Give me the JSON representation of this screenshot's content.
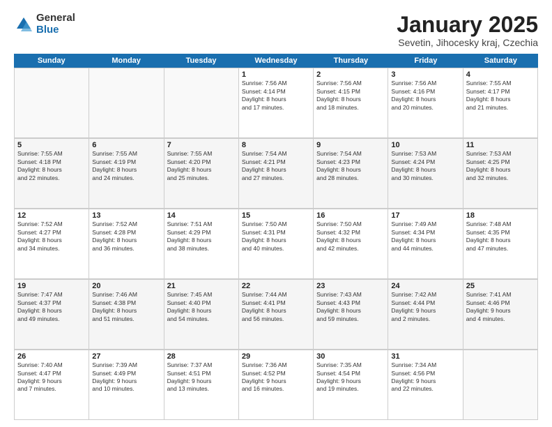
{
  "logo": {
    "general": "General",
    "blue": "Blue"
  },
  "title": "January 2025",
  "subtitle": "Sevetin, Jihocesky kraj, Czechia",
  "weekdays": [
    "Sunday",
    "Monday",
    "Tuesday",
    "Wednesday",
    "Thursday",
    "Friday",
    "Saturday"
  ],
  "weeks": [
    [
      {
        "day": "",
        "info": ""
      },
      {
        "day": "",
        "info": ""
      },
      {
        "day": "",
        "info": ""
      },
      {
        "day": "1",
        "info": "Sunrise: 7:56 AM\nSunset: 4:14 PM\nDaylight: 8 hours\nand 17 minutes."
      },
      {
        "day": "2",
        "info": "Sunrise: 7:56 AM\nSunset: 4:15 PM\nDaylight: 8 hours\nand 18 minutes."
      },
      {
        "day": "3",
        "info": "Sunrise: 7:56 AM\nSunset: 4:16 PM\nDaylight: 8 hours\nand 20 minutes."
      },
      {
        "day": "4",
        "info": "Sunrise: 7:55 AM\nSunset: 4:17 PM\nDaylight: 8 hours\nand 21 minutes."
      }
    ],
    [
      {
        "day": "5",
        "info": "Sunrise: 7:55 AM\nSunset: 4:18 PM\nDaylight: 8 hours\nand 22 minutes."
      },
      {
        "day": "6",
        "info": "Sunrise: 7:55 AM\nSunset: 4:19 PM\nDaylight: 8 hours\nand 24 minutes."
      },
      {
        "day": "7",
        "info": "Sunrise: 7:55 AM\nSunset: 4:20 PM\nDaylight: 8 hours\nand 25 minutes."
      },
      {
        "day": "8",
        "info": "Sunrise: 7:54 AM\nSunset: 4:21 PM\nDaylight: 8 hours\nand 27 minutes."
      },
      {
        "day": "9",
        "info": "Sunrise: 7:54 AM\nSunset: 4:23 PM\nDaylight: 8 hours\nand 28 minutes."
      },
      {
        "day": "10",
        "info": "Sunrise: 7:53 AM\nSunset: 4:24 PM\nDaylight: 8 hours\nand 30 minutes."
      },
      {
        "day": "11",
        "info": "Sunrise: 7:53 AM\nSunset: 4:25 PM\nDaylight: 8 hours\nand 32 minutes."
      }
    ],
    [
      {
        "day": "12",
        "info": "Sunrise: 7:52 AM\nSunset: 4:27 PM\nDaylight: 8 hours\nand 34 minutes."
      },
      {
        "day": "13",
        "info": "Sunrise: 7:52 AM\nSunset: 4:28 PM\nDaylight: 8 hours\nand 36 minutes."
      },
      {
        "day": "14",
        "info": "Sunrise: 7:51 AM\nSunset: 4:29 PM\nDaylight: 8 hours\nand 38 minutes."
      },
      {
        "day": "15",
        "info": "Sunrise: 7:50 AM\nSunset: 4:31 PM\nDaylight: 8 hours\nand 40 minutes."
      },
      {
        "day": "16",
        "info": "Sunrise: 7:50 AM\nSunset: 4:32 PM\nDaylight: 8 hours\nand 42 minutes."
      },
      {
        "day": "17",
        "info": "Sunrise: 7:49 AM\nSunset: 4:34 PM\nDaylight: 8 hours\nand 44 minutes."
      },
      {
        "day": "18",
        "info": "Sunrise: 7:48 AM\nSunset: 4:35 PM\nDaylight: 8 hours\nand 47 minutes."
      }
    ],
    [
      {
        "day": "19",
        "info": "Sunrise: 7:47 AM\nSunset: 4:37 PM\nDaylight: 8 hours\nand 49 minutes."
      },
      {
        "day": "20",
        "info": "Sunrise: 7:46 AM\nSunset: 4:38 PM\nDaylight: 8 hours\nand 51 minutes."
      },
      {
        "day": "21",
        "info": "Sunrise: 7:45 AM\nSunset: 4:40 PM\nDaylight: 8 hours\nand 54 minutes."
      },
      {
        "day": "22",
        "info": "Sunrise: 7:44 AM\nSunset: 4:41 PM\nDaylight: 8 hours\nand 56 minutes."
      },
      {
        "day": "23",
        "info": "Sunrise: 7:43 AM\nSunset: 4:43 PM\nDaylight: 8 hours\nand 59 minutes."
      },
      {
        "day": "24",
        "info": "Sunrise: 7:42 AM\nSunset: 4:44 PM\nDaylight: 9 hours\nand 2 minutes."
      },
      {
        "day": "25",
        "info": "Sunrise: 7:41 AM\nSunset: 4:46 PM\nDaylight: 9 hours\nand 4 minutes."
      }
    ],
    [
      {
        "day": "26",
        "info": "Sunrise: 7:40 AM\nSunset: 4:47 PM\nDaylight: 9 hours\nand 7 minutes."
      },
      {
        "day": "27",
        "info": "Sunrise: 7:39 AM\nSunset: 4:49 PM\nDaylight: 9 hours\nand 10 minutes."
      },
      {
        "day": "28",
        "info": "Sunrise: 7:37 AM\nSunset: 4:51 PM\nDaylight: 9 hours\nand 13 minutes."
      },
      {
        "day": "29",
        "info": "Sunrise: 7:36 AM\nSunset: 4:52 PM\nDaylight: 9 hours\nand 16 minutes."
      },
      {
        "day": "30",
        "info": "Sunrise: 7:35 AM\nSunset: 4:54 PM\nDaylight: 9 hours\nand 19 minutes."
      },
      {
        "day": "31",
        "info": "Sunrise: 7:34 AM\nSunset: 4:56 PM\nDaylight: 9 hours\nand 22 minutes."
      },
      {
        "day": "",
        "info": ""
      }
    ]
  ]
}
